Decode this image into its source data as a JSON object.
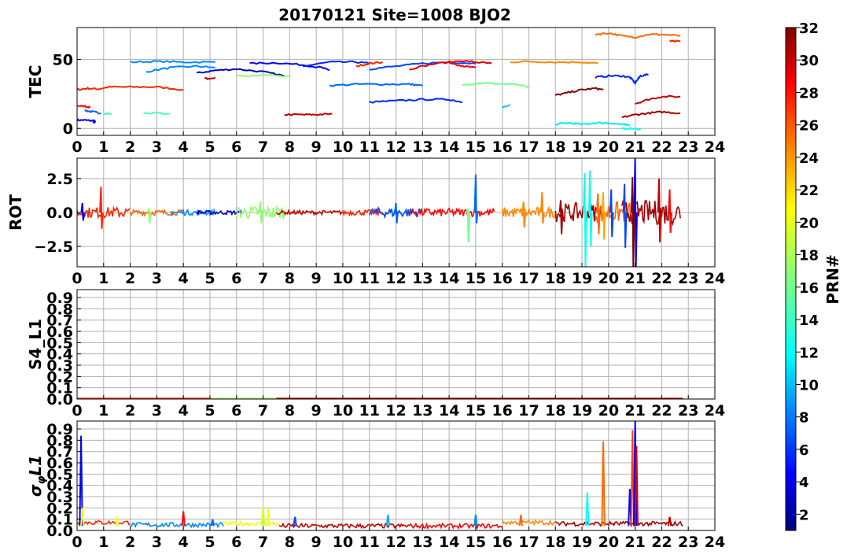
{
  "chart_data": {
    "title": "20170121 Site=1008 BJO2",
    "x_ticks": [
      "0",
      "1",
      "2",
      "3",
      "4",
      "5",
      "6",
      "7",
      "8",
      "9",
      "10",
      "11",
      "12",
      "13",
      "14",
      "15",
      "16",
      "17",
      "18",
      "19",
      "20",
      "21",
      "22",
      "23",
      "24"
    ],
    "xlim": [
      0,
      24
    ],
    "grid": true,
    "colorbar": {
      "label": "PRN#",
      "range": [
        1,
        32
      ],
      "ticks": [
        "2",
        "4",
        "6",
        "8",
        "10",
        "12",
        "14",
        "16",
        "18",
        "20",
        "22",
        "24",
        "26",
        "28",
        "30",
        "32"
      ],
      "colormap": "jet"
    },
    "panels": [
      {
        "id": "tec",
        "type": "line",
        "ylabel": "TEC",
        "ylim": [
          -5,
          73
        ],
        "y_ticks": [
          {
            "v": 0,
            "t": "0"
          },
          {
            "v": 50,
            "t": "50"
          }
        ],
        "series": [
          {
            "prn": 5,
            "x": [
              0.0,
              0.3,
              0.6,
              0.7
            ],
            "y": [
              6,
              6,
              5.5,
              5
            ]
          },
          {
            "prn": 28,
            "x": [
              0.0,
              0.3,
              0.5
            ],
            "y": [
              16,
              16,
              15
            ]
          },
          {
            "prn": 27,
            "x": [
              0.0,
              0.4,
              0.8,
              1.2,
              2.0,
              3.0,
              4.0
            ],
            "y": [
              28,
              29,
              28.5,
              30,
              30,
              30,
              28
            ]
          },
          {
            "prn": 8,
            "x": [
              0.3,
              0.6,
              0.9
            ],
            "y": [
              13,
              12,
              11
            ]
          },
          {
            "prn": 15,
            "x": [
              1.0,
              1.3
            ],
            "y": [
              11,
              10.5
            ]
          },
          {
            "prn": 9,
            "x": [
              2.0,
              3.0,
              4.0,
              5.2
            ],
            "y": [
              48,
              48.5,
              48,
              48
            ]
          },
          {
            "prn": 9,
            "x": [
              2.6,
              3.5,
              4.5,
              5.2
            ],
            "y": [
              41,
              44,
              45,
              44
            ]
          },
          {
            "prn": 15,
            "x": [
              2.5,
              3.0,
              3.5
            ],
            "y": [
              11,
              11,
              10.5
            ]
          },
          {
            "prn": 3,
            "x": [
              4.5,
              5.2,
              6.0,
              7.0,
              7.8
            ],
            "y": [
              40,
              42,
              43,
              41,
              38
            ]
          },
          {
            "prn": 30,
            "x": [
              4.8,
              5.2
            ],
            "y": [
              36,
              37
            ]
          },
          {
            "prn": 17,
            "x": [
              6.0,
              7.0,
              8.0
            ],
            "y": [
              38,
              38.5,
              38
            ]
          },
          {
            "prn": 5,
            "x": [
              6.5,
              7.5,
              8.5,
              9.2,
              9.5
            ],
            "y": [
              47,
              47.5,
              46,
              44,
              42
            ]
          },
          {
            "prn": 6,
            "x": [
              8.5,
              9.5,
              10.5,
              11.0
            ],
            "y": [
              45,
              48,
              48,
              47
            ]
          },
          {
            "prn": 30,
            "x": [
              7.8,
              8.5,
              9.0,
              9.6
            ],
            "y": [
              10,
              10,
              10,
              10.5
            ]
          },
          {
            "prn": 27,
            "x": [
              10.5,
              11.0,
              11.5
            ],
            "y": [
              45,
              47,
              48
            ]
          },
          {
            "prn": 8,
            "x": [
              9.5,
              10.5,
              11.5,
              12.5,
              13.0
            ],
            "y": [
              31,
              32,
              32,
              32,
              31
            ]
          },
          {
            "prn": 6,
            "x": [
              11.0,
              12.0,
              13.0,
              14.0,
              14.5
            ],
            "y": [
              19,
              20,
              21,
              21,
              19
            ]
          },
          {
            "prn": 7,
            "x": [
              11.0,
              12.0,
              13.0,
              14.0,
              15.0
            ],
            "y": [
              43,
              45,
              47,
              48,
              47
            ]
          },
          {
            "prn": 29,
            "x": [
              12.5,
              13.5,
              14.5,
              15.0,
              15.6
            ],
            "y": [
              43,
              47,
              49,
              48,
              47
            ]
          },
          {
            "prn": 28,
            "x": [
              14.0,
              14.5,
              15.0
            ],
            "y": [
              47,
              45,
              44
            ]
          },
          {
            "prn": 16,
            "x": [
              14.5,
              15.5,
              16.5,
              17.0
            ],
            "y": [
              32,
              32.5,
              32,
              30
            ]
          },
          {
            "prn": 11,
            "x": [
              16.0,
              16.3
            ],
            "y": [
              15,
              17
            ]
          },
          {
            "prn": 24,
            "x": [
              16.3,
              17.0,
              18.0,
              19.0,
              19.6
            ],
            "y": [
              48,
              48.5,
              48,
              48,
              47
            ]
          },
          {
            "prn": 32,
            "x": [
              18.0,
              18.5,
              19.0,
              19.5,
              19.8
            ],
            "y": [
              24,
              26,
              28,
              29,
              28
            ]
          },
          {
            "prn": 12,
            "x": [
              18.0,
              18.5,
              19.0,
              19.5,
              20.0,
              20.5,
              20.8
            ],
            "y": [
              3,
              4,
              3,
              4,
              4,
              3,
              2
            ]
          },
          {
            "prn": 13,
            "x": [
              20.5,
              21.0,
              21.2
            ],
            "y": [
              0,
              0,
              -1
            ]
          },
          {
            "prn": 6,
            "x": [
              19.5,
              20.0,
              20.5,
              20.8,
              21.0,
              21.2,
              21.5
            ],
            "y": [
              37,
              38,
              38,
              37,
              33,
              38,
              39
            ]
          },
          {
            "prn": 25,
            "x": [
              19.5,
              20.0,
              20.5,
              21.0,
              21.5,
              22.0,
              22.7
            ],
            "y": [
              68,
              69,
              67,
              66,
              68,
              68,
              67
            ]
          },
          {
            "prn": 27,
            "x": [
              22.3,
              22.7
            ],
            "y": [
              63,
              63
            ]
          },
          {
            "prn": 31,
            "x": [
              20.5,
              21.0,
              21.5,
              22.0,
              22.7
            ],
            "y": [
              8,
              10,
              11,
              12,
              11
            ]
          },
          {
            "prn": 30,
            "x": [
              21.0,
              21.5,
              22.0,
              22.7
            ],
            "y": [
              18,
              21,
              23,
              23
            ]
          }
        ]
      },
      {
        "id": "rot",
        "type": "line",
        "ylabel": "ROT",
        "ylim": [
          -4,
          4
        ],
        "y_ticks": [
          {
            "v": 2.5,
            "t": "2.5"
          },
          {
            "v": 0,
            "t": "0.0"
          },
          {
            "v": -2.5,
            "t": "−2.5"
          }
        ],
        "spikes": [
          {
            "prn": 27,
            "x": 0.9,
            "lo": -1.2,
            "hi": 1.9
          },
          {
            "prn": 5,
            "x": 0.2,
            "lo": -0.6,
            "hi": 0.7
          },
          {
            "prn": 17,
            "x": 2.7,
            "lo": -0.8,
            "hi": 0.3
          },
          {
            "prn": 17,
            "x": 6.9,
            "lo": -0.8,
            "hi": 0.8
          },
          {
            "prn": 8,
            "x": 12.0,
            "lo": -0.8,
            "hi": 0.7
          },
          {
            "prn": 8,
            "x": 15.0,
            "lo": -0.8,
            "hi": 2.8
          },
          {
            "prn": 16,
            "x": 14.7,
            "lo": -2.2,
            "hi": 0.3
          },
          {
            "prn": 24,
            "x": 16.8,
            "lo": -1.1,
            "hi": 0.8
          },
          {
            "prn": 24,
            "x": 17.5,
            "lo": -0.8,
            "hi": 1.5
          },
          {
            "prn": 31,
            "x": 18.2,
            "lo": -1.6,
            "hi": 0.9
          },
          {
            "prn": 13,
            "x": 19.1,
            "lo": -4.0,
            "hi": 2.9
          },
          {
            "prn": 13,
            "x": 19.3,
            "lo": -2.5,
            "hi": 3.1
          },
          {
            "prn": 25,
            "x": 19.6,
            "lo": -1.6,
            "hi": 1.4
          },
          {
            "prn": 23,
            "x": 19.8,
            "lo": -2.0,
            "hi": 1.5
          },
          {
            "prn": 7,
            "x": 20.1,
            "lo": -1.8,
            "hi": 1.7
          },
          {
            "prn": 7,
            "x": 20.6,
            "lo": -2.6,
            "hi": 2.1
          },
          {
            "prn": 5,
            "x": 21.0,
            "lo": -4.0,
            "hi": 4.0
          },
          {
            "prn": 32,
            "x": 20.9,
            "lo": -4.0,
            "hi": 2.6
          },
          {
            "prn": 30,
            "x": 21.9,
            "lo": -2.2,
            "hi": 2.5
          },
          {
            "prn": 28,
            "x": 22.3,
            "lo": -1.5,
            "hi": 1.7
          }
        ],
        "noise_bands": [
          {
            "prn": 27,
            "x0": 0.0,
            "x1": 2.0,
            "amp": 0.4
          },
          {
            "prn": 25,
            "x0": 2.0,
            "x1": 4.0,
            "amp": 0.2
          },
          {
            "prn": 9,
            "x0": 3.5,
            "x1": 5.2,
            "amp": 0.2
          },
          {
            "prn": 3,
            "x0": 4.5,
            "x1": 6.2,
            "amp": 0.15
          },
          {
            "prn": 17,
            "x0": 6.0,
            "x1": 7.8,
            "amp": 0.5
          },
          {
            "prn": 30,
            "x0": 7.5,
            "x1": 10.0,
            "amp": 0.15
          },
          {
            "prn": 27,
            "x0": 10.0,
            "x1": 11.5,
            "amp": 0.2
          },
          {
            "prn": 7,
            "x0": 11.0,
            "x1": 13.0,
            "amp": 0.35
          },
          {
            "prn": 28,
            "x0": 12.5,
            "x1": 15.7,
            "amp": 0.3
          },
          {
            "prn": 24,
            "x0": 16.0,
            "x1": 18.0,
            "amp": 0.4
          },
          {
            "prn": 31,
            "x0": 18.0,
            "x1": 19.8,
            "amp": 0.7
          },
          {
            "prn": 25,
            "x0": 19.5,
            "x1": 21.0,
            "amp": 0.8
          },
          {
            "prn": 31,
            "x0": 20.5,
            "x1": 22.7,
            "amp": 0.9
          }
        ]
      },
      {
        "id": "s4",
        "type": "line",
        "ylabel": "S4_L1",
        "ylim": [
          0,
          0.97
        ],
        "y_ticks": [
          {
            "v": 0.0,
            "t": "0.0"
          },
          {
            "v": 0.1,
            "t": "0.1"
          },
          {
            "v": 0.2,
            "t": "0.2"
          },
          {
            "v": 0.3,
            "t": "0.3"
          },
          {
            "v": 0.4,
            "t": "0.4"
          },
          {
            "v": 0.5,
            "t": "0.5"
          },
          {
            "v": 0.6,
            "t": "0.6"
          },
          {
            "v": 0.7,
            "t": "0.7"
          },
          {
            "v": 0.8,
            "t": "0.8"
          },
          {
            "v": 0.9,
            "t": "0.9"
          }
        ],
        "flat_lines": [
          {
            "prn": 27,
            "x0": 0.0,
            "x1": 5.0,
            "y": 0.004
          },
          {
            "prn": 18,
            "x0": 5.0,
            "x1": 8.0,
            "y": 0.004
          },
          {
            "prn": 30,
            "x0": 7.5,
            "x1": 22.8,
            "y": 0.004
          }
        ]
      },
      {
        "id": "sigma",
        "type": "line",
        "ylabel": "σ_φL1",
        "ylim": [
          0,
          0.97
        ],
        "y_ticks": [
          {
            "v": 0.0,
            "t": "0.0"
          },
          {
            "v": 0.1,
            "t": "0.1"
          },
          {
            "v": 0.2,
            "t": "0.2"
          },
          {
            "v": 0.3,
            "t": "0.3"
          },
          {
            "v": 0.4,
            "t": "0.4"
          },
          {
            "v": 0.5,
            "t": "0.5"
          },
          {
            "v": 0.6,
            "t": "0.6"
          },
          {
            "v": 0.7,
            "t": "0.7"
          },
          {
            "v": 0.8,
            "t": "0.8"
          },
          {
            "v": 0.9,
            "t": "0.9"
          }
        ],
        "baseline": [
          {
            "prn": 27,
            "x0": 0.0,
            "x1": 2.0,
            "y": 0.07
          },
          {
            "prn": 9,
            "x0": 2.0,
            "x1": 5.5,
            "y": 0.05
          },
          {
            "prn": 20,
            "x0": 5.5,
            "x1": 7.6,
            "y": 0.06
          },
          {
            "prn": 30,
            "x0": 7.6,
            "x1": 12.5,
            "y": 0.04
          },
          {
            "prn": 28,
            "x0": 12.5,
            "x1": 16.0,
            "y": 0.04
          },
          {
            "prn": 24,
            "x0": 16.0,
            "x1": 18.0,
            "y": 0.07
          },
          {
            "prn": 31,
            "x0": 18.0,
            "x1": 22.8,
            "y": 0.06
          }
        ],
        "spikes": [
          {
            "prn": 5,
            "x": 0.15,
            "hi": 0.84
          },
          {
            "prn": 20,
            "x": 0.2,
            "hi": 0.2
          },
          {
            "prn": 20,
            "x": 1.5,
            "hi": 0.12
          },
          {
            "prn": 28,
            "x": 4.0,
            "hi": 0.17
          },
          {
            "prn": 8,
            "x": 5.1,
            "hi": 0.1
          },
          {
            "prn": 19,
            "x": 7.0,
            "hi": 0.22
          },
          {
            "prn": 20,
            "x": 7.2,
            "hi": 0.19
          },
          {
            "prn": 7,
            "x": 8.2,
            "hi": 0.12
          },
          {
            "prn": 10,
            "x": 11.7,
            "hi": 0.14
          },
          {
            "prn": 9,
            "x": 15.0,
            "hi": 0.14
          },
          {
            "prn": 25,
            "x": 16.7,
            "hi": 0.14
          },
          {
            "prn": 13,
            "x": 19.2,
            "hi": 0.34
          },
          {
            "prn": 25,
            "x": 19.8,
            "hi": 0.79
          },
          {
            "prn": 5,
            "x": 20.8,
            "hi": 0.37
          },
          {
            "prn": 26,
            "x": 20.9,
            "hi": 0.89
          },
          {
            "prn": 5,
            "x": 21.0,
            "hi": 0.97
          },
          {
            "prn": 29,
            "x": 21.05,
            "hi": 0.75
          },
          {
            "prn": 30,
            "x": 22.3,
            "hi": 0.12
          }
        ]
      }
    ]
  }
}
